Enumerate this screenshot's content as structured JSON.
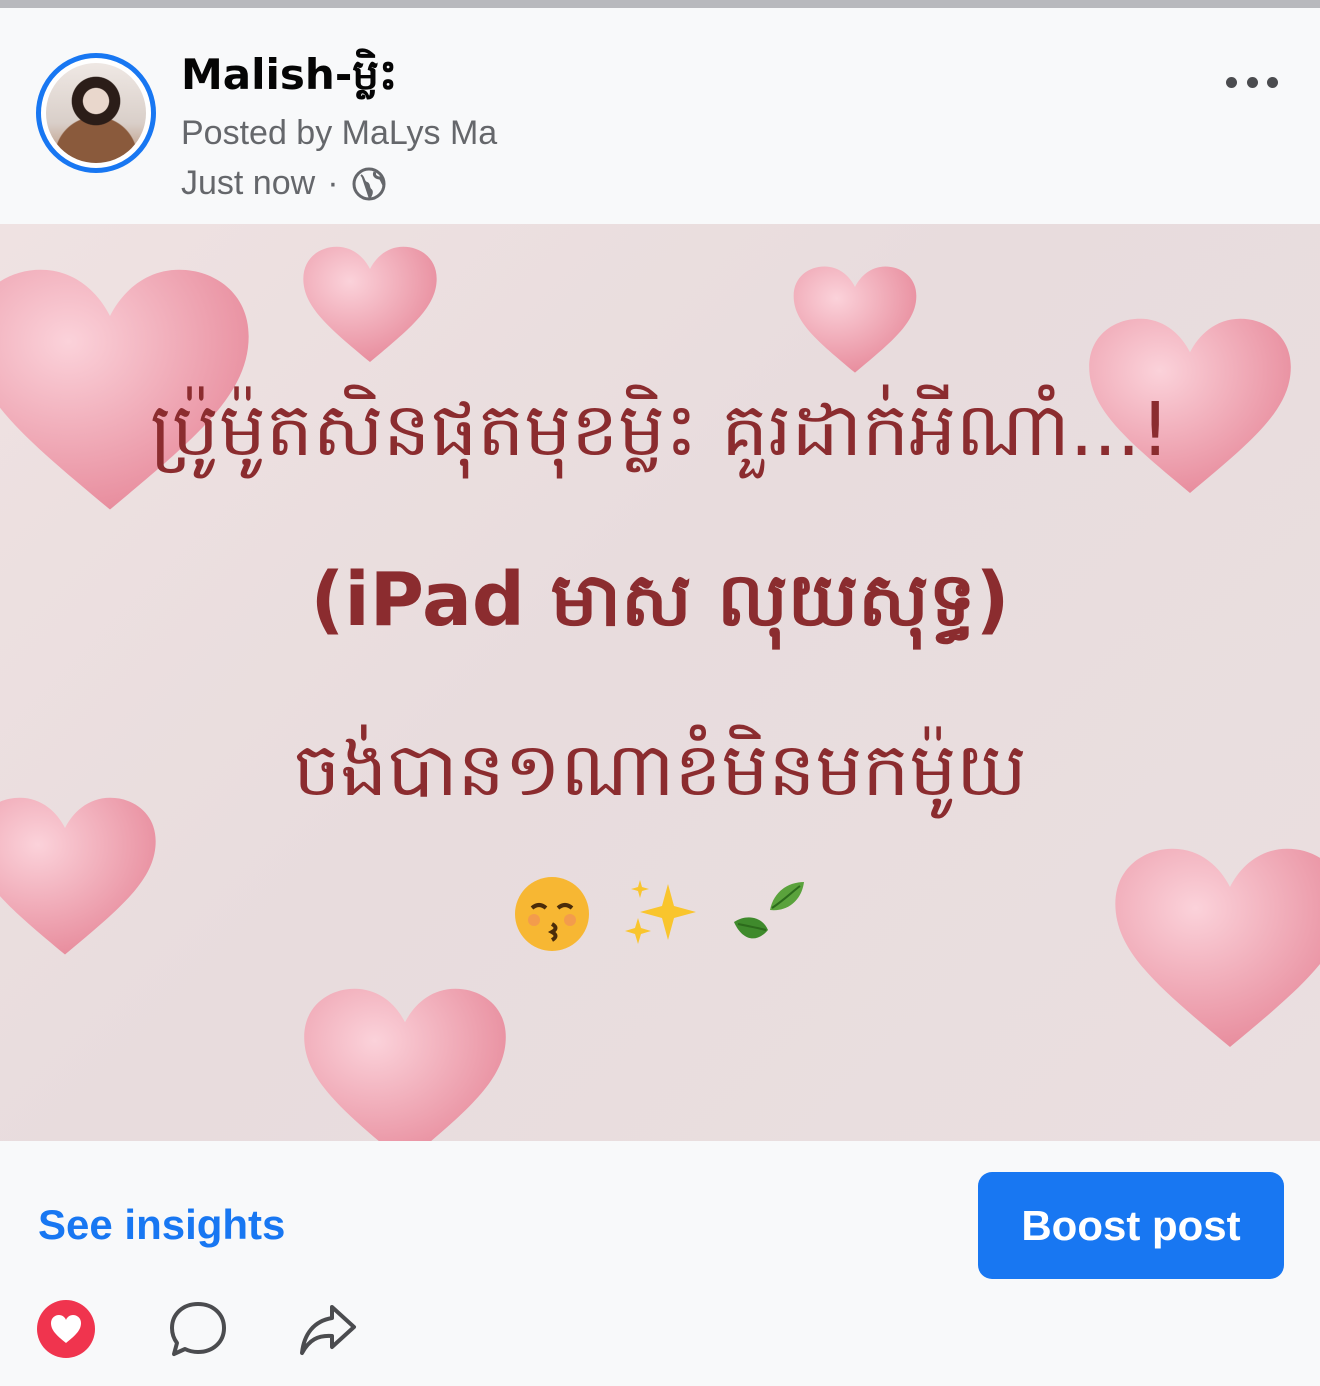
{
  "post": {
    "page_name": "Malish-ម្លិះ",
    "posted_by": "Posted by MaLys Ma",
    "timestamp": "Just now",
    "separator": "·",
    "privacy_icon": "globe-icon",
    "more_icon": "more-options-icon"
  },
  "image": {
    "line1": "ប្រ៉ូម៉ូតសិនផុតមុខម្លិះ គួរដាក់អីណាំ...!",
    "line2": "(iPad  មាស លុយសុទ្ធ)",
    "line3": "ចង់បាន១ណាខំមិនមកម៉ូយ",
    "emojis": [
      "😚",
      "✨",
      "🍃"
    ]
  },
  "footer": {
    "see_insights": "See insights",
    "boost_post": "Boost post",
    "icons": [
      "love-reaction-icon",
      "comment-icon",
      "share-icon"
    ]
  },
  "colors": {
    "accent": "#1877f2",
    "image_text": "#8b2c2f",
    "heart": "#f2a7b3"
  }
}
